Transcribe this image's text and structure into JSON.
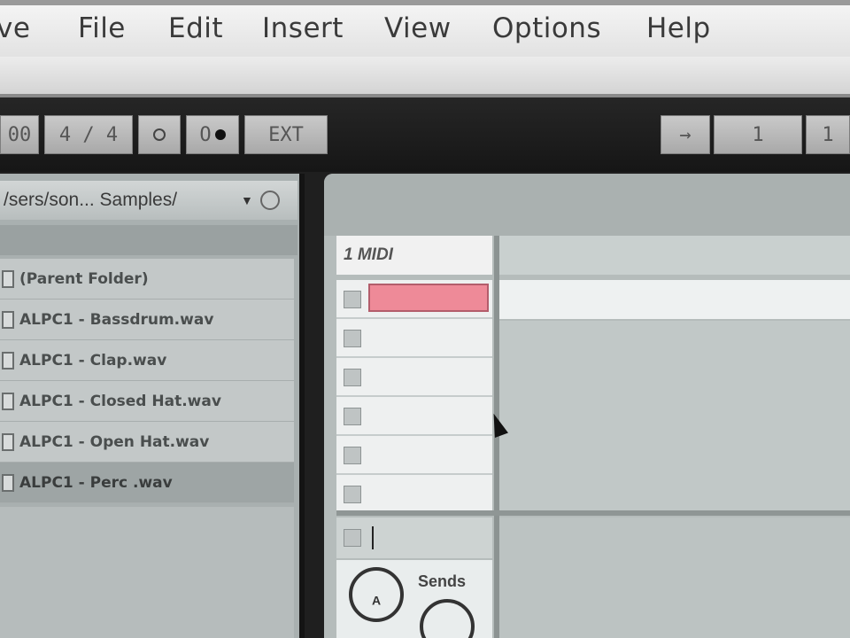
{
  "menubar": {
    "items": [
      "ve",
      "File",
      "Edit",
      "Insert",
      "View",
      "Options",
      "Help"
    ]
  },
  "transport": {
    "tempo_fragment": "00",
    "signature": "4 / 4",
    "metro_label": "O",
    "ext_label": "EXT",
    "right_arrow": "→",
    "right_a": "1",
    "right_b": "1"
  },
  "browser": {
    "path": "/sers/son... Samples/",
    "files": [
      "(Parent Folder)",
      "ALPC1 - Bassdrum.wav",
      "ALPC1 - Clap.wav",
      "ALPC1 - Closed Hat.wav",
      "ALPC1 - Open Hat.wav",
      "ALPC1 - Perc .wav"
    ],
    "selected_index": 5
  },
  "session": {
    "track_name": "1 MIDI",
    "sends_label": "Sends",
    "knob_a": "A",
    "colors": {
      "clip": "#ee8a98"
    }
  },
  "icons": [
    "arrow-down-icon",
    "gear-icon",
    "file-icon",
    "record-icon",
    "cursor-icon"
  ]
}
